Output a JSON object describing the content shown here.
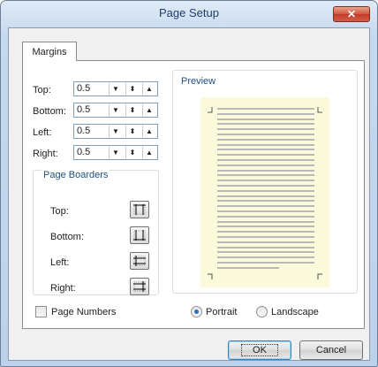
{
  "window": {
    "title": "Page Setup",
    "close_glyph": "✕"
  },
  "tabs": [
    {
      "label": "Margins"
    }
  ],
  "margins": [
    {
      "label": "Top:",
      "value": "0.5"
    },
    {
      "label": "Bottom:",
      "value": "0.5"
    },
    {
      "label": "Left:",
      "value": "0.5"
    },
    {
      "label": "Right:",
      "value": "0.5"
    }
  ],
  "spin_glyphs": {
    "dropdown": "▼",
    "spin": "⬍",
    "up": "▲"
  },
  "page_borders": {
    "title": "Page Boarders",
    "items": [
      {
        "label": "Top:"
      },
      {
        "label": "Bottom:"
      },
      {
        "label": "Left:"
      },
      {
        "label": "Right:"
      }
    ]
  },
  "preview": {
    "title": "Preview"
  },
  "page_numbers": {
    "label": "Page Numbers",
    "checked": false
  },
  "orientation": {
    "portrait": "Portrait",
    "landscape": "Landscape",
    "selected": "portrait"
  },
  "buttons": {
    "ok": "OK",
    "cancel": "Cancel"
  }
}
